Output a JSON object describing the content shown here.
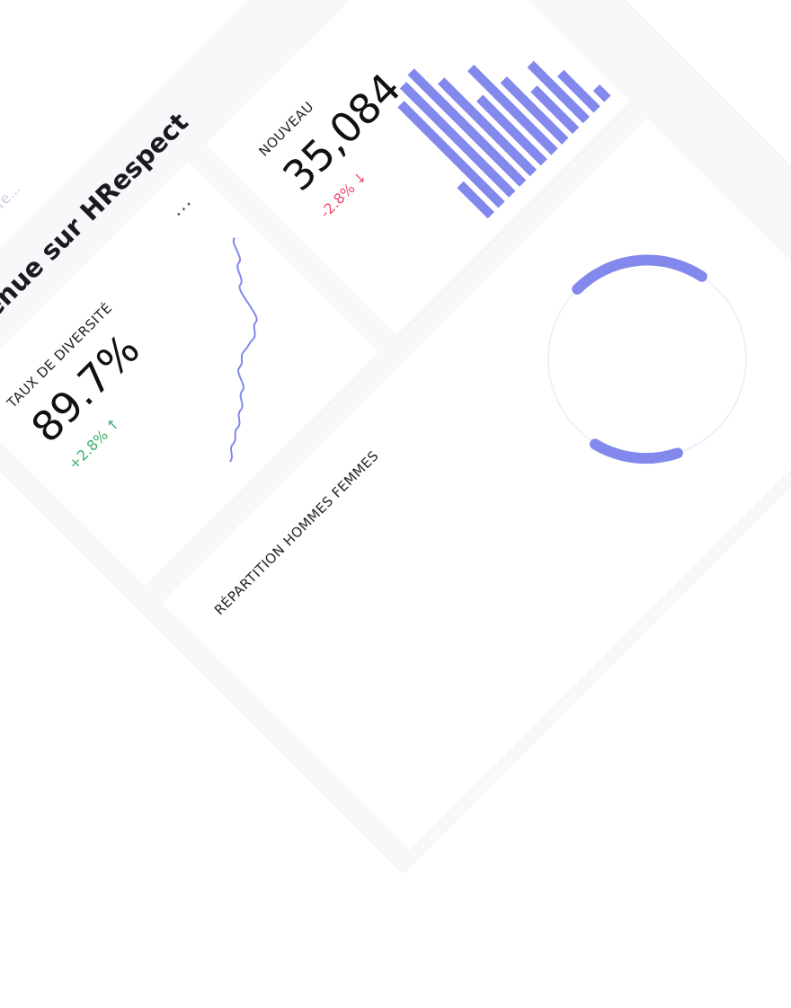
{
  "header": {
    "search_placeholder": "Search here..."
  },
  "page": {
    "title": "Bienvenue sur HRespect"
  },
  "cards": {
    "diversity": {
      "label": "TAUX DE DIVERSITÉ",
      "value": "89.7%",
      "delta": "+2.8%",
      "delta_arrow": "↑",
      "trend": "up",
      "menu": "···"
    },
    "new_hires": {
      "label": "NOUVEAU",
      "value": "35,084",
      "delta": "-2.8%",
      "delta_arrow": "↓",
      "trend": "down"
    },
    "gender": {
      "label": "RÉPARTITION HOMMES FEMMES"
    }
  },
  "colors": {
    "accent": "#8288ec",
    "positive": "#38b26a",
    "negative": "#ef4a6a",
    "placeholder": "#c3cde0"
  },
  "chart_data": [
    {
      "type": "line",
      "values": [
        5,
        10,
        14,
        19,
        25,
        34,
        38,
        39,
        44,
        62,
        70,
        80
      ]
    },
    {
      "type": "bar",
      "values": [
        22,
        72,
        78,
        80,
        66,
        46,
        60,
        44,
        30,
        40,
        26,
        8
      ]
    }
  ]
}
